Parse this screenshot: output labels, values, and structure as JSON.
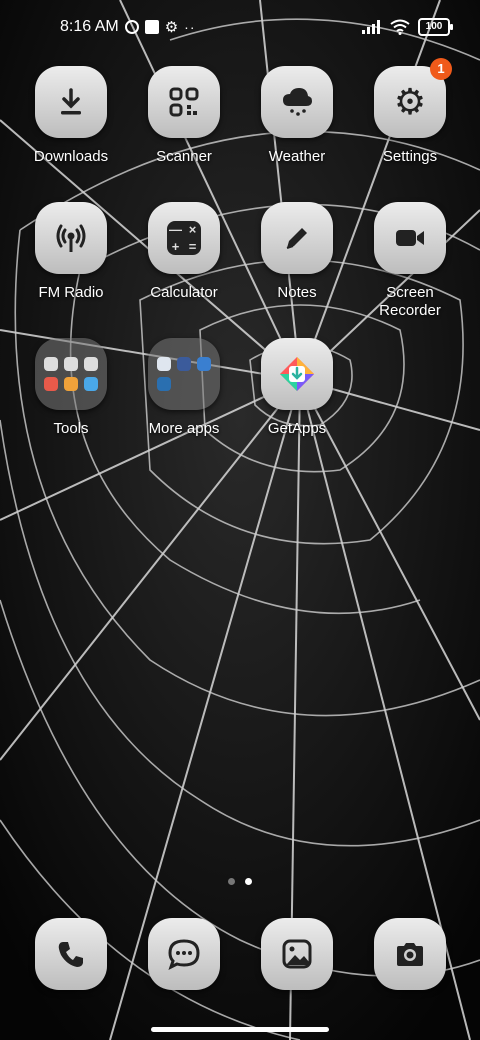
{
  "status_bar": {
    "time": "8:16 AM",
    "battery": "100"
  },
  "apps": [
    {
      "label": "Downloads",
      "icon": "download-icon"
    },
    {
      "label": "Scanner",
      "icon": "qr-scanner-icon"
    },
    {
      "label": "Weather",
      "icon": "weather-cloud-icon"
    },
    {
      "label": "Settings",
      "icon": "gear-icon",
      "badge": "1"
    },
    {
      "label": "FM Radio",
      "icon": "radio-icon"
    },
    {
      "label": "Calculator",
      "icon": "calculator-icon"
    },
    {
      "label": "Notes",
      "icon": "pencil-icon"
    },
    {
      "label": "Screen\nRecorder",
      "icon": "video-camera-icon"
    },
    {
      "label": "Tools",
      "icon": "folder-icon"
    },
    {
      "label": "More apps",
      "icon": "folder-icon"
    },
    {
      "label": "GetApps",
      "icon": "getapps-icon"
    }
  ],
  "dock": [
    {
      "icon": "phone-icon"
    },
    {
      "icon": "messages-icon"
    },
    {
      "icon": "gallery-icon"
    },
    {
      "icon": "camera-icon"
    }
  ],
  "page_indicator": {
    "pages": 2,
    "current": 2
  }
}
